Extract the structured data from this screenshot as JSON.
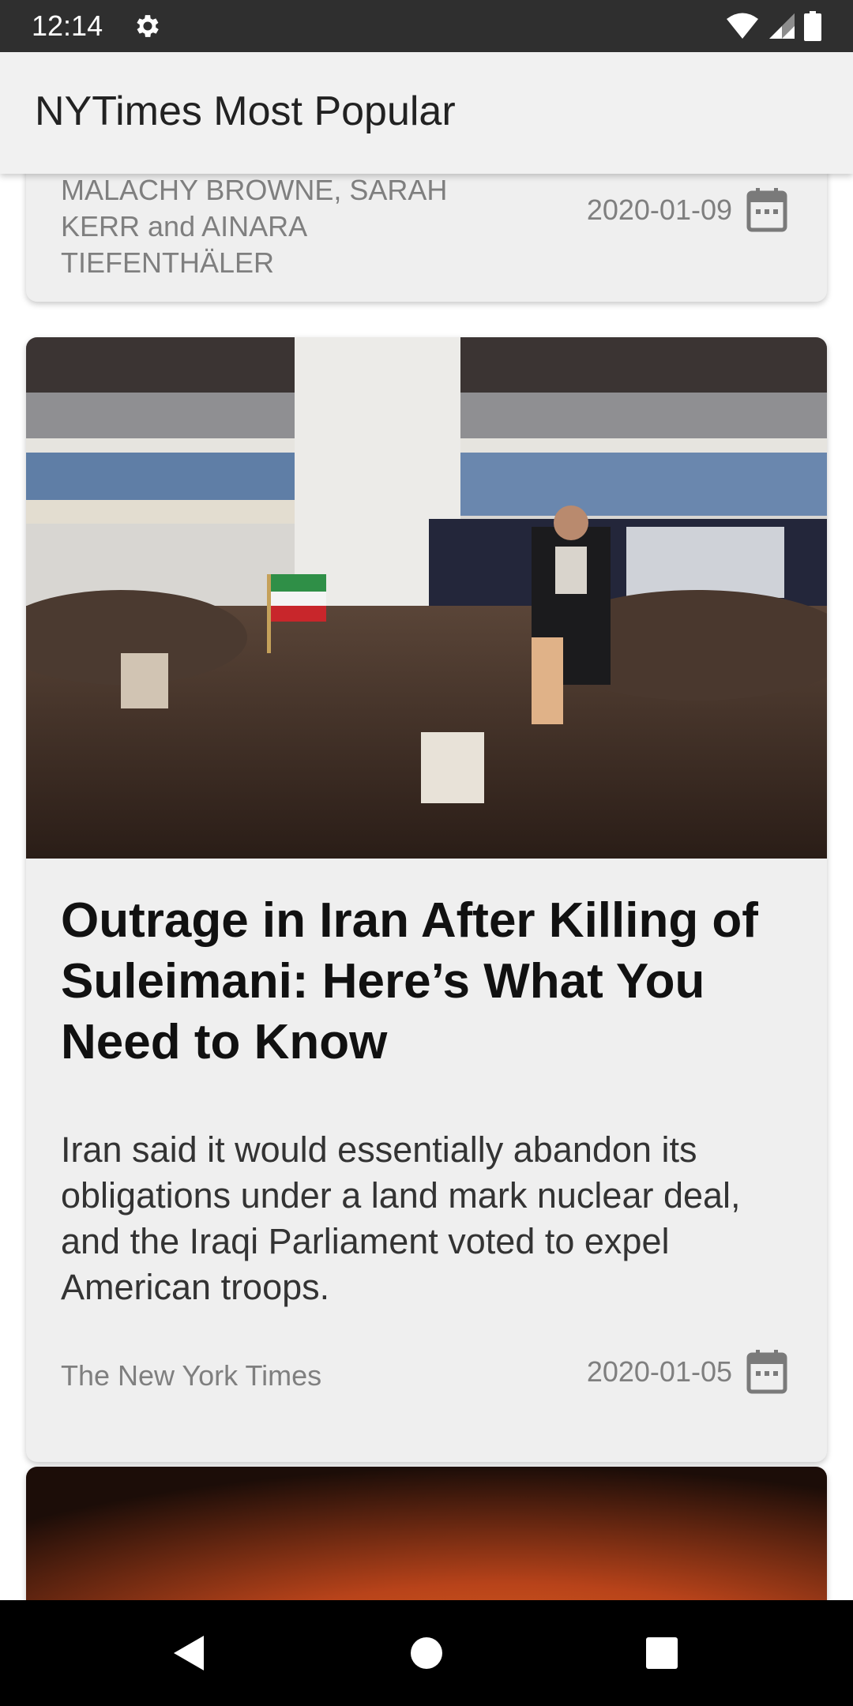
{
  "status_bar": {
    "time": "12:14",
    "icons": [
      "gear-icon",
      "wifi-icon",
      "signal-icon",
      "battery-icon"
    ]
  },
  "app_bar": {
    "title": "NYTimes Most Popular"
  },
  "articles": [
    {
      "byline": "MALACHY BROWNE, SARAH KERR and AINARA TIEFENTHÄLER",
      "date": "2020-01-09"
    },
    {
      "title": "Outrage in Iran After Killing of Suleimani: Here’s What You Need to Know",
      "abstract": "Iran said it would essentially abandon its obligations under a land mark nuclear deal, and the Iraqi Parliament voted to expel American troops.",
      "byline": "The New York Times",
      "date": "2020-01-05",
      "image": "crowd-photo"
    },
    {
      "image": "fire-photo"
    }
  ],
  "nav_bar": {
    "buttons": [
      "back-icon",
      "home-icon",
      "recents-icon"
    ]
  },
  "colors": {
    "status_bar": "#2f2f2f",
    "app_bar": "#f1f1f1",
    "card": "#efefef",
    "secondary_text": "#7f7f7f",
    "title_text": "#111111"
  }
}
